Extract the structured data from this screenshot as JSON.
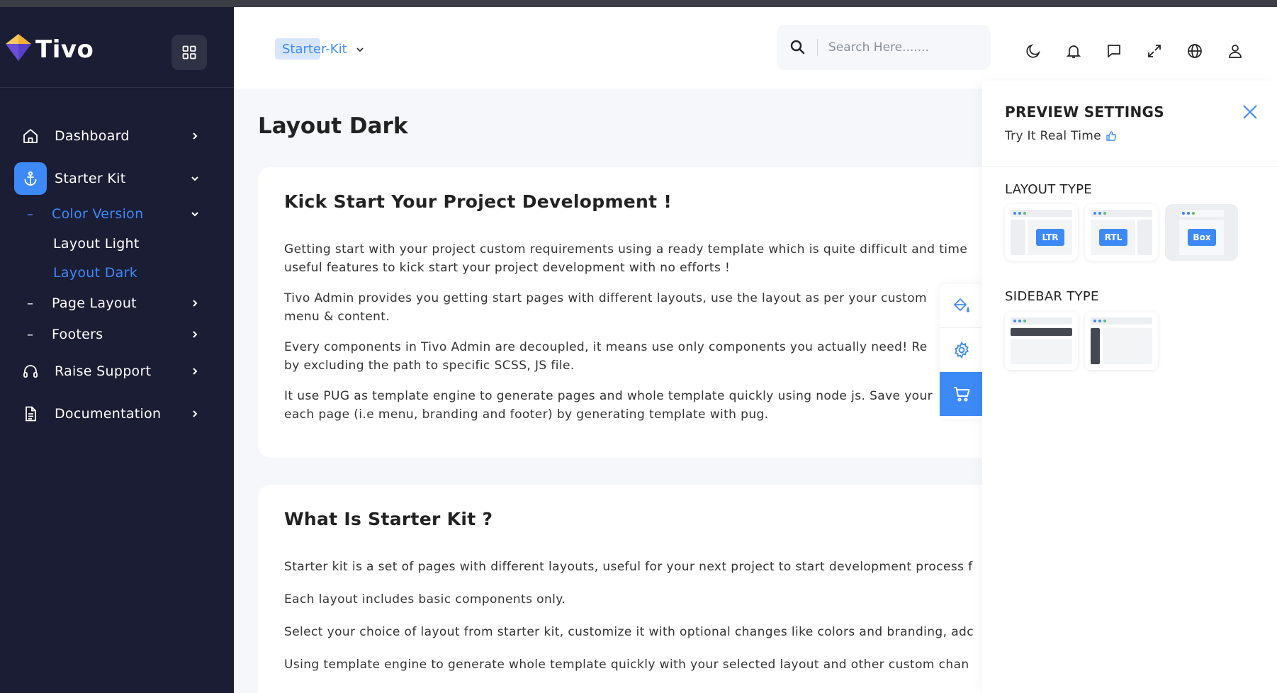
{
  "brand": {
    "name": "Tivo"
  },
  "sidebar": {
    "items": [
      {
        "label": "Dashboard",
        "icon": "home-icon"
      },
      {
        "label": "Starter Kit",
        "icon": "anchor-icon"
      },
      {
        "label": "Color Version"
      },
      {
        "label": "Layout Light"
      },
      {
        "label": "Layout Dark"
      },
      {
        "label": "Page Layout"
      },
      {
        "label": "Footers"
      },
      {
        "label": "Raise Support",
        "icon": "headphones-icon"
      },
      {
        "label": "Documentation",
        "icon": "document-icon"
      }
    ]
  },
  "header": {
    "breadcrumb": "Starter-Kit",
    "search_placeholder": "Search Here.......",
    "icons": [
      "moon-icon",
      "bell-icon",
      "chat-icon",
      "expand-icon",
      "globe-icon",
      "user-icon"
    ]
  },
  "main": {
    "title": "Layout Dark",
    "card1": {
      "heading": "Kick Start Your Project Development !",
      "p1a": "Getting start with your project custom requirements using a ready template which is quite difficult and time",
      "p1b": "useful features to kick start your project development with no efforts !",
      "p2a": "Tivo Admin provides you getting start pages with different layouts, use the layout as per your custom",
      "p2b": "menu & content.",
      "p3a": "Every components in Tivo Admin are decoupled, it means use only components you actually need! Re",
      "p3b": "by excluding the path to specific SCSS, JS file.",
      "p4a": "It use PUG as template engine to generate pages and whole template quickly using node js. Save your",
      "p4b": "each page (i.e menu, branding and footer) by generating template with pug."
    },
    "card2": {
      "heading": "What Is Starter Kit ?",
      "p1": "Starter kit is a set of pages with different layouts, useful for your next project to start development process f",
      "p2": "Each layout includes basic components only.",
      "p3": "Select your choice of layout from starter kit, customize it with optional changes like colors and branding, adc",
      "p4": "Using template engine to generate whole template quickly with your selected layout and other custom chan"
    }
  },
  "preview": {
    "title": "PREVIEW SETTINGS",
    "subtitle": "Try It Real Time",
    "layout_type_label": "LAYOUT TYPE",
    "layout_options": [
      "LTR",
      "RTL",
      "Box"
    ],
    "selected_layout": "Box",
    "sidebar_type_label": "SIDEBAR TYPE"
  },
  "colors": {
    "accent": "#3d8af7",
    "sidebar_bg": "#1a1d33",
    "page_bg": "#f5f7fb",
    "dot_blue": "#3d8af7",
    "dot_green": "#5bbf6a"
  }
}
